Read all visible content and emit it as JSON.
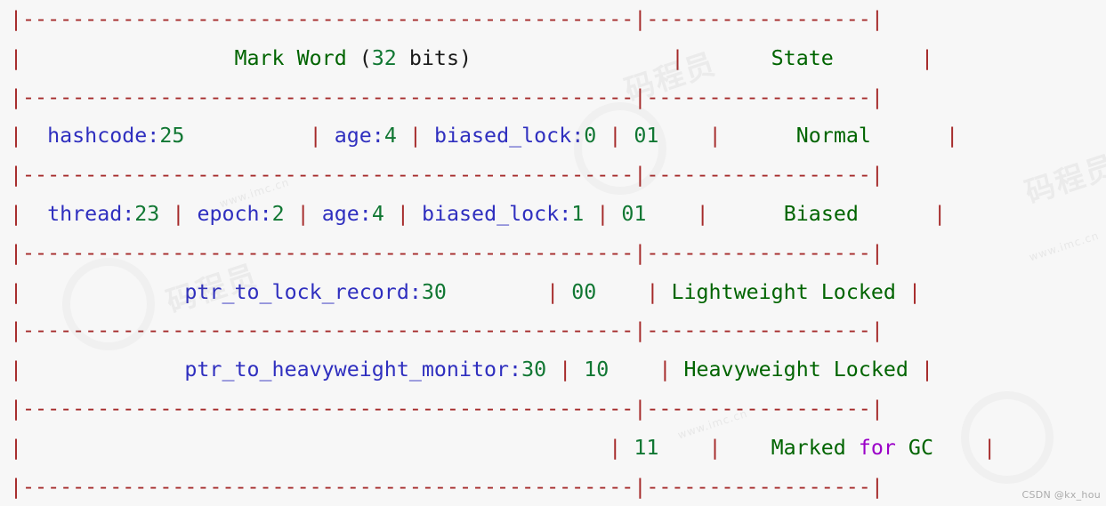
{
  "block": {
    "language": "plaintext",
    "background_color": "#f7f7f7",
    "border_char": "|",
    "rule_char": "-"
  },
  "colors": {
    "border": "#a52a2a",
    "identifier": "#2f2fbf",
    "number": "#117733",
    "state_text": "#006400",
    "keyword": "#9b00c8",
    "plain": "#1a1a1a",
    "background": "#f7f7f7"
  },
  "table": {
    "header": {
      "markword_label": "Mark Word",
      "markword_paren_open": "(",
      "markword_bits_value": "32",
      "markword_bits_word": " bits",
      "markword_paren_close": ")",
      "state_label": "State"
    },
    "rules": {
      "left_rule": "-------------------------------------------------",
      "right_rule": "------------------",
      "pipe": "|"
    },
    "rows": [
      {
        "name": "normal",
        "fields": [
          {
            "label": "hashcode:",
            "value": "25"
          },
          {
            "label": "age:",
            "value": "4"
          },
          {
            "label": "biased_lock:",
            "value": "0"
          }
        ],
        "tag_bits": "01",
        "state": "Normal"
      },
      {
        "name": "biased",
        "fields": [
          {
            "label": "thread:",
            "value": "23"
          },
          {
            "label": "epoch:",
            "value": "2"
          },
          {
            "label": "age:",
            "value": "4"
          },
          {
            "label": "biased_lock:",
            "value": "1"
          }
        ],
        "tag_bits": "01",
        "state": "Biased"
      },
      {
        "name": "lightweight-locked",
        "fields": [
          {
            "label": "ptr_to_lock_record:",
            "value": "30"
          }
        ],
        "tag_bits": "00",
        "state": "Lightweight Locked"
      },
      {
        "name": "heavyweight-locked",
        "fields": [
          {
            "label": "ptr_to_heavyweight_monitor:",
            "value": "30"
          }
        ],
        "tag_bits": "10",
        "state": "Heavyweight Locked"
      },
      {
        "name": "marked-for-gc",
        "fields": [],
        "tag_bits": "11",
        "state_part1": "Marked",
        "state_keyword": "for",
        "state_part2": "GC"
      }
    ]
  },
  "watermarks": {
    "credit": "CSDN @kx_hou",
    "brand_1": "码程员",
    "brand_2": "码程员",
    "brand_3": "码程员",
    "url_1": "www.imc.cn",
    "url_2": "www.imc.cn",
    "url_3": "www.imc.cn"
  }
}
